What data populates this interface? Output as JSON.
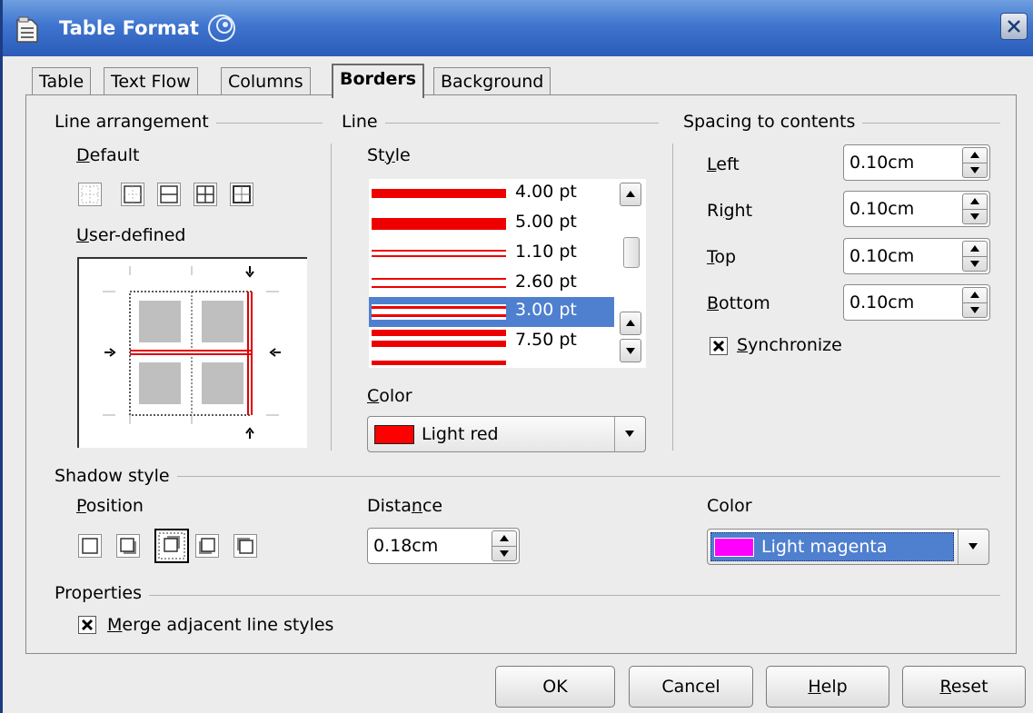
{
  "window": {
    "title": "Table Format"
  },
  "tabs": [
    {
      "label": "Table",
      "active": false
    },
    {
      "label": "Text Flow",
      "active": false
    },
    {
      "label": "Columns",
      "active": false
    },
    {
      "label": "Borders",
      "active": true
    },
    {
      "label": "Background",
      "active": false
    }
  ],
  "line_arrangement": {
    "title": "Line arrangement",
    "default_label": "Default",
    "user_defined_label": "User-defined"
  },
  "line": {
    "title": "Line",
    "style_label": "Style",
    "styles": [
      {
        "value": "4.00 pt",
        "selected": false
      },
      {
        "value": "5.00 pt",
        "selected": false
      },
      {
        "value": "1.10 pt",
        "selected": false
      },
      {
        "value": "2.60 pt",
        "selected": false
      },
      {
        "value": "3.00 pt",
        "selected": true
      },
      {
        "value": "7.50 pt",
        "selected": false
      }
    ],
    "color_label": "Color",
    "color_value": "Light red",
    "color_hex": "#ff0000"
  },
  "spacing": {
    "title": "Spacing to contents",
    "left_label": "Left",
    "left_value": "0.10cm",
    "right_label": "Right",
    "right_value": "0.10cm",
    "top_label": "Top",
    "top_value": "0.10cm",
    "bottom_label": "Bottom",
    "bottom_value": "0.10cm",
    "synchronize_label": "Synchronize",
    "synchronize_checked": true
  },
  "shadow": {
    "title": "Shadow style",
    "position_label": "Position",
    "distance_label": "Distance",
    "distance_value": "0.18cm",
    "color_label": "Color",
    "color_value": "Light magenta",
    "color_hex": "#ff00ff"
  },
  "properties": {
    "title": "Properties",
    "merge_label": "Merge adjacent line styles",
    "merge_checked": true
  },
  "buttons": {
    "ok": "OK",
    "cancel": "Cancel",
    "help": "Help",
    "reset": "Reset"
  },
  "colors": {
    "titlebar": "#3f75cf",
    "selection": "#4f7fcf",
    "accent_red": "#ff0000",
    "accent_magenta": "#ff00ff"
  }
}
